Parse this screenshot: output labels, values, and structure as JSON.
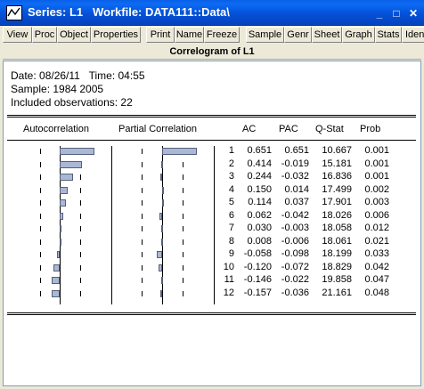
{
  "window": {
    "title_prefix": "Series: L1",
    "workfile": "Workfile: DATA111::Data\\",
    "buttons": [
      "_",
      "□",
      "✕"
    ]
  },
  "toolbar": {
    "items": [
      "View",
      "Proc",
      "Object",
      "Properties",
      "Print",
      "Name",
      "Freeze",
      "Sample",
      "Genr",
      "Sheet",
      "Graph",
      "Stats",
      "Ident"
    ]
  },
  "doc": {
    "header": "Correlogram of L1",
    "date_line": "Date: 08/26/11   Time: 04:55",
    "sample_line": "Sample: 1984 2005",
    "obs_line": "Included observations: 22"
  },
  "table": {
    "headers": [
      "Autocorrelation",
      "Partial Correlation",
      "AC",
      "PAC",
      "Q-Stat",
      "Prob"
    ],
    "rows": [
      {
        "lag": "1",
        "ac": "0.651",
        "pac": "0.651",
        "q": "10.667",
        "prob": "0.001"
      },
      {
        "lag": "2",
        "ac": "0.414",
        "pac": "-0.019",
        "q": "15.181",
        "prob": "0.001"
      },
      {
        "lag": "3",
        "ac": "0.244",
        "pac": "-0.032",
        "q": "16.836",
        "prob": "0.001"
      },
      {
        "lag": "4",
        "ac": "0.150",
        "pac": "0.014",
        "q": "17.499",
        "prob": "0.002"
      },
      {
        "lag": "5",
        "ac": "0.114",
        "pac": "0.037",
        "q": "17.901",
        "prob": "0.003"
      },
      {
        "lag": "6",
        "ac": "0.062",
        "pac": "-0.042",
        "q": "18.026",
        "prob": "0.006"
      },
      {
        "lag": "7",
        "ac": "0.030",
        "pac": "-0.003",
        "q": "18.058",
        "prob": "0.012"
      },
      {
        "lag": "8",
        "ac": "0.008",
        "pac": "-0.006",
        "q": "18.061",
        "prob": "0.021"
      },
      {
        "lag": "9",
        "ac": "-0.058",
        "pac": "-0.098",
        "q": "18.199",
        "prob": "0.033"
      },
      {
        "lag": "10",
        "ac": "-0.120",
        "pac": "-0.072",
        "q": "18.829",
        "prob": "0.042"
      },
      {
        "lag": "11",
        "ac": "-0.146",
        "pac": "-0.022",
        "q": "19.858",
        "prob": "0.047"
      },
      {
        "lag": "12",
        "ac": "-0.157",
        "pac": "-0.036",
        "q": "21.161",
        "prob": "0.048"
      }
    ]
  },
  "colors": {
    "title_bar": "#0551d8",
    "bar_fill": "#aab8d6",
    "bar_border": "#55607a"
  }
}
